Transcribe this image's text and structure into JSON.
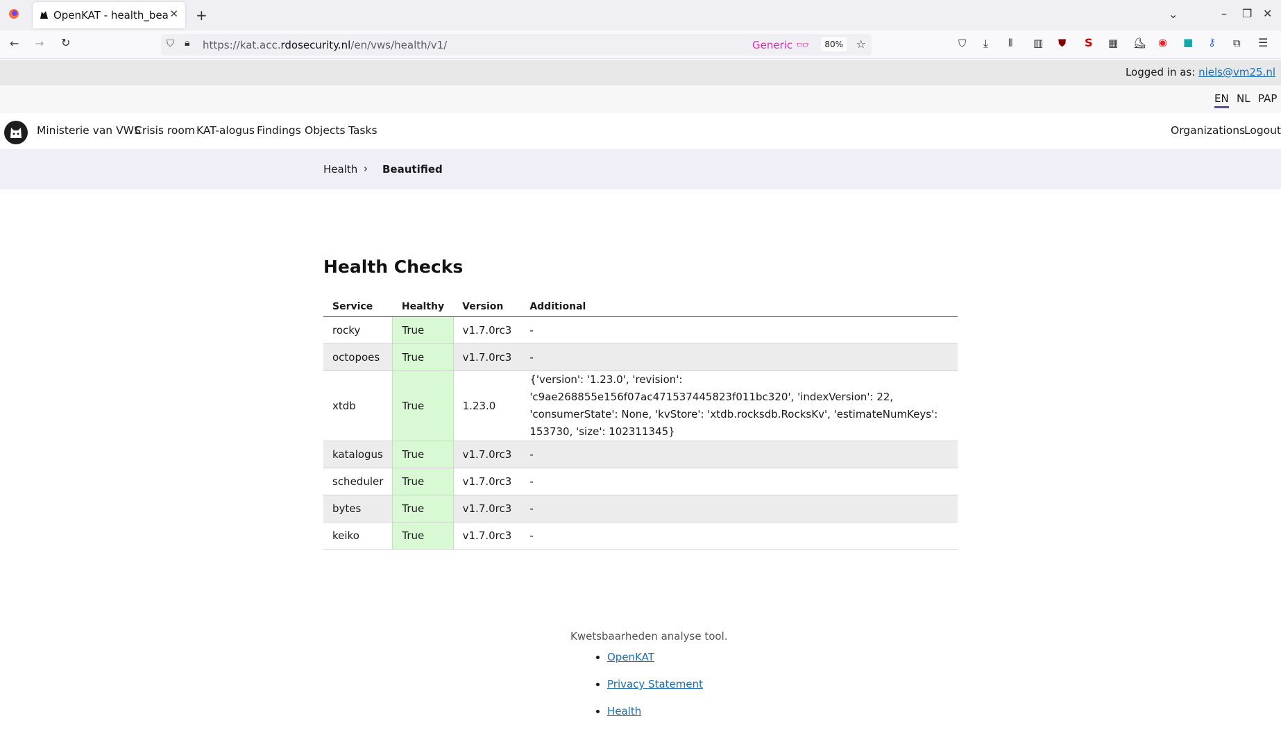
{
  "browser": {
    "tab_title": "OpenKAT - health_beautified",
    "url_prefix": "https://kat.acc.",
    "url_domain": "rdosecurity.nl",
    "url_path": "/en/vws/health/v1/",
    "generic_label": "Generic",
    "zoom": "80%"
  },
  "login": {
    "label": "Logged in as:",
    "email": "niels@vm25.nl"
  },
  "languages": [
    "EN",
    "NL",
    "PAP"
  ],
  "nav": {
    "org": "Ministerie van VWS",
    "items": [
      "Crisis room",
      "KAT-alogus",
      "Findings",
      "Objects",
      "Tasks"
    ],
    "right": [
      "Organizations",
      "Logout"
    ]
  },
  "breadcrumb": {
    "parent": "Health",
    "separator": "›",
    "current": "Beautified"
  },
  "page_title": "Health Checks",
  "table": {
    "headers": [
      "Service",
      "Healthy",
      "Version",
      "Additional"
    ],
    "rows": [
      {
        "service": "rocky",
        "healthy": "True",
        "version": "v1.7.0rc3",
        "additional": "-"
      },
      {
        "service": "octopoes",
        "healthy": "True",
        "version": "v1.7.0rc3",
        "additional": "-"
      },
      {
        "service": "xtdb",
        "healthy": "True",
        "version": "1.23.0",
        "additional": "{'version': '1.23.0', 'revision': 'c9ae268855e156f07ac471537445823f011bc320', 'indexVersion': 22, 'consumerState': None, 'kvStore': 'xtdb.rocksdb.RocksKv', 'estimateNumKeys': 153730, 'size': 102311345}"
      },
      {
        "service": "katalogus",
        "healthy": "True",
        "version": "v1.7.0rc3",
        "additional": "-"
      },
      {
        "service": "scheduler",
        "healthy": "True",
        "version": "v1.7.0rc3",
        "additional": "-"
      },
      {
        "service": "bytes",
        "healthy": "True",
        "version": "v1.7.0rc3",
        "additional": "-"
      },
      {
        "service": "keiko",
        "healthy": "True",
        "version": "v1.7.0rc3",
        "additional": "-"
      }
    ]
  },
  "footer": {
    "tagline": "Kwetsbaarheden analyse tool.",
    "links": [
      "OpenKAT",
      "Privacy Statement",
      "Health"
    ]
  },
  "colors": {
    "healthy_bg": "#d9f9d5",
    "accent": "#5a4db0",
    "link": "#1a6fb5"
  }
}
